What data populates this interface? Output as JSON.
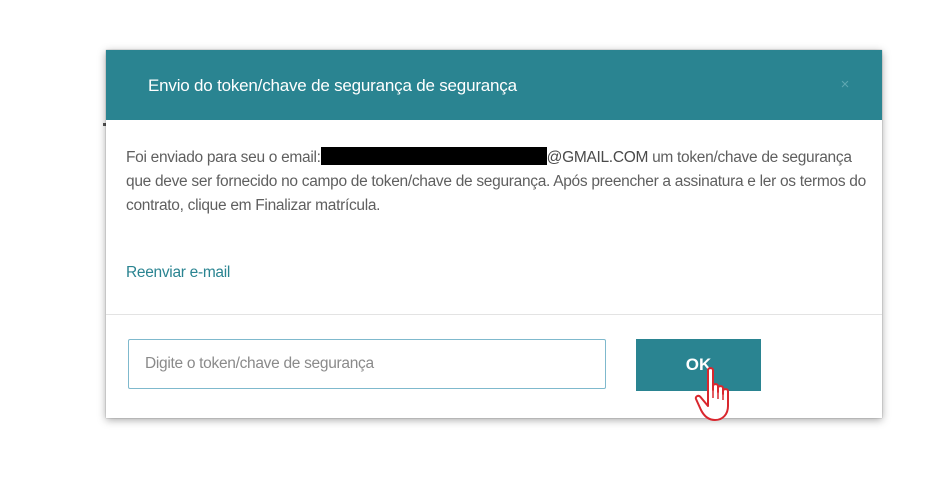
{
  "dialog": {
    "title": "Envio do token/chave de segurança de segurança",
    "close_icon": "close-icon",
    "close_glyph": "×",
    "message": {
      "prefix": "Foi enviado para seu o email:",
      "email_domain": "@GMAIL.COM",
      "suffix": " um token/chave de segurança que deve ser fornecido no campo de token/chave de segurança. Após preencher a assinatura e ler os termos do contrato, clique em Finalizar matrícula."
    },
    "resend_link": "Reenviar e-mail",
    "token_input": {
      "value": "",
      "placeholder": "Digite o token/chave de segurança"
    },
    "ok_button": "OK",
    "cursor_icon": "hand-pointer-icon"
  },
  "colors": {
    "header_bg": "#2a8491",
    "button_bg": "#2a8491",
    "link": "#2a8491",
    "input_border": "#7fb9cd",
    "body_text": "#5f5f5f",
    "cursor_outline": "#d9272e"
  }
}
